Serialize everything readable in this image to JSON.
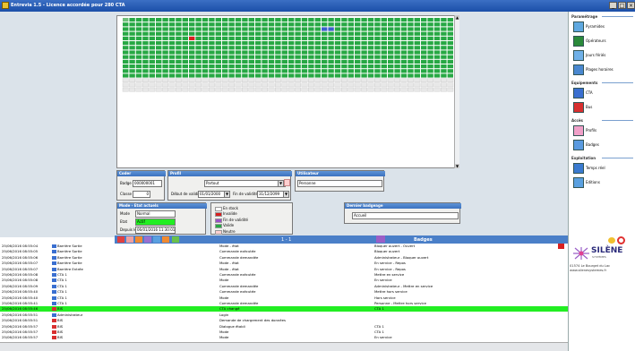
{
  "window": {
    "title": "Entrevia 1.5 - Licence accordée pour 280 CTA",
    "min": "_",
    "max": "□",
    "close": "×"
  },
  "badge_grid": {
    "columns": 50,
    "rows": 16,
    "states": {
      "green": "#27a844",
      "red": "#d82020",
      "blue": "#3a5fcc",
      "empty": "#e8e8e8"
    }
  },
  "colors": {
    "accent": "#4a7fc8",
    "selected_row": "#22ee22",
    "panel_header": "#5f94d7"
  },
  "coder": {
    "header": "Coder",
    "badge_label": "Badge",
    "badge_value": "000000001",
    "classe_label": "Classe",
    "classe_value": "0"
  },
  "profil": {
    "header": "Profil",
    "value": "Partout",
    "debut_label": "Début de validité",
    "debut_value": "01/01/2000",
    "fin_label": "Fin de validité",
    "fin_value": "31/12/2099"
  },
  "utilisateur": {
    "header": "Utilisateur",
    "value": "Personne"
  },
  "mode": {
    "header": "Mode - Etat actuels",
    "mode_label": "Mode",
    "mode_value": "Normal",
    "etat_label": "Etat",
    "etat_value": "Actif",
    "depuis_label": "Depuis le",
    "depuis_value": "06/01/2016 11:30:01"
  },
  "legend": {
    "items": [
      {
        "label": "En stock",
        "color": "#ffffff"
      },
      {
        "label": "Invalide",
        "color": "#d82020"
      },
      {
        "label": "Fin de validité",
        "color": "#9b4fc8"
      },
      {
        "label": "Valide",
        "color": "#27a844"
      },
      {
        "label": "Neutre",
        "color": "#ffd0d0"
      }
    ]
  },
  "dernier_badgeage": {
    "header": "Dernier badgeage",
    "value": "Accueil"
  },
  "toolbar": {
    "pager": "1 - 1",
    "section": "Badges"
  },
  "log": {
    "rows": [
      {
        "time": "25/06/2016 08:55:04",
        "src": "Barrière Sortie",
        "type": "Mode - état",
        "detail": "Bloquer ouvert - Ouvert",
        "icon": "#3a6fd0"
      },
      {
        "time": "25/06/2016 08:55:05",
        "src": "Barrière Sortie",
        "type": "Commande exécutée",
        "detail": "Bloquer ouvert",
        "icon": "#3a6fd0"
      },
      {
        "time": "25/06/2016 08:55:06",
        "src": "Barrière Sortie",
        "type": "Commande demandée",
        "detail": "Administrateur - Bloquer ouvert",
        "icon": "#3a6fd0"
      },
      {
        "time": "25/06/2016 08:55:07",
        "src": "Barrière Sortie",
        "type": "Mode - état",
        "detail": "En service - Repos",
        "icon": "#3a6fd0"
      },
      {
        "time": "25/06/2016 08:55:07",
        "src": "Barrière Entrée",
        "type": "Mode - état",
        "detail": "En service - Repos",
        "icon": "#3a6fd0"
      },
      {
        "time": "25/06/2016 08:55:08",
        "src": "CTA 1",
        "type": "Commande exécutée",
        "detail": "Mettre en service",
        "icon": "#3a6fd0"
      },
      {
        "time": "25/06/2016 08:55:08",
        "src": "CTA 1",
        "type": "Mode",
        "detail": "En service",
        "icon": "#3a6fd0"
      },
      {
        "time": "25/06/2016 08:55:09",
        "src": "CTA 1",
        "type": "Commande demandée",
        "detail": "Administrateur - Mettre en service",
        "icon": "#3a6fd0"
      },
      {
        "time": "25/06/2016 08:55:40",
        "src": "CTA 1",
        "type": "Commande exécutée",
        "detail": "Mettre hors service",
        "icon": "#3a6fd0"
      },
      {
        "time": "25/06/2016 08:55:40",
        "src": "CTA 1",
        "type": "Mode",
        "detail": "Hors service",
        "icon": "#3a6fd0"
      },
      {
        "time": "25/06/2016 08:55:41",
        "src": "CTA 1",
        "type": "Commande demandée",
        "detail": "Personne - Mettre hors service",
        "icon": "#3a6fd0"
      },
      {
        "time": "25/06/2016 08:55:46",
        "src": "BIS",
        "type": "CTA changé",
        "detail": "CTA 1",
        "icon": "#d83030",
        "selected": true
      },
      {
        "time": "25/06/2016 08:55:51",
        "src": "Administrateur",
        "type": "Login",
        "detail": "",
        "icon": "#3a6fd0"
      },
      {
        "time": "25/06/2016 08:55:51",
        "src": "BIS",
        "type": "Demande de chargement des données",
        "detail": "",
        "icon": "#d83030"
      },
      {
        "time": "25/06/2016 08:55:57",
        "src": "BIS",
        "type": "Dialogue établi",
        "detail": "CTA 1",
        "icon": "#d83030"
      },
      {
        "time": "25/06/2016 08:55:57",
        "src": "BIS",
        "type": "Mode",
        "detail": "CTA 1",
        "icon": "#d83030"
      },
      {
        "time": "25/06/2016 08:55:57",
        "src": "BIS",
        "type": "Mode",
        "detail": "En service",
        "icon": "#d83030"
      }
    ]
  },
  "sidebar": {
    "sections": [
      {
        "title": "Paramétrage",
        "items": [
          {
            "label": "Pyramides",
            "icon": "pyramid-icon",
            "color": "#5fa8e0"
          },
          {
            "label": "Opérateurs",
            "icon": "operator-icon",
            "color": "#2a8a3a"
          },
          {
            "label": "Jours fériés",
            "icon": "calendar-icon",
            "color": "#6fb0e8"
          },
          {
            "label": "Plages horaires",
            "icon": "clock-icon",
            "color": "#4a88d0"
          }
        ]
      },
      {
        "title": "Equipements",
        "items": [
          {
            "label": "CTA",
            "icon": "cta-icon",
            "color": "#3a6fd0"
          },
          {
            "label": "Bus",
            "icon": "bus-icon",
            "color": "#d83030"
          }
        ]
      },
      {
        "title": "Accès",
        "items": [
          {
            "label": "Profils",
            "icon": "profile-icon",
            "color": "#f0a0c8"
          },
          {
            "label": "Badges",
            "icon": "badge-icon",
            "color": "#5a9ae0"
          }
        ]
      },
      {
        "title": "Exploitation",
        "items": [
          {
            "label": "Temps réel",
            "icon": "realtime-icon",
            "color": "#3a7ad0"
          },
          {
            "label": "Editions",
            "icon": "print-icon",
            "color": "#5aa0e0"
          }
        ]
      }
    ]
  },
  "logo": {
    "name": "SILÈNE",
    "sub": "SYSTÈMES",
    "address": "01574 Le Bourget du Lac",
    "url": "www.silenesystemes.fr"
  }
}
